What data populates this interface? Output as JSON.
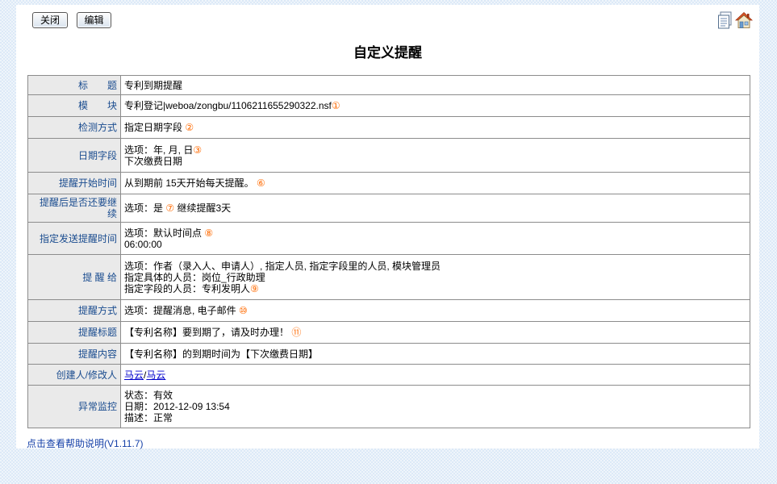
{
  "toolbar": {
    "close_label": "关闭",
    "edit_label": "编辑"
  },
  "page_title": "自定义提醒",
  "labels": {
    "title": "标　　题",
    "module": "模　　块",
    "detect": "检测方式",
    "date_field": "日期字段",
    "start_time": "提醒开始时间",
    "continue": "提醒后是否还要继续",
    "send_time": "指定发送提醒时间",
    "remind_to": "提 醒 给",
    "method": "提醒方式",
    "subject": "提醒标题",
    "content": "提醒内容",
    "creator": "创建人/修改人",
    "monitor": "异常监控"
  },
  "values": {
    "title": "专利到期提醒",
    "module": "专利登记|weboa/zongbu/1106211655290322.nsf",
    "module_num": "①",
    "detect": "指定日期字段",
    "detect_num": "②",
    "date_field_line1": "选项：年, 月, 日",
    "date_field_num": "③",
    "date_field_line2": "下次缴费日期",
    "start_time": "从到期前 15天开始每天提醒。",
    "start_time_num": "⑥",
    "continue_prefix": "选项：是",
    "continue_num": "⑦",
    "continue_suffix": "继续提醒3天",
    "send_time_line1": "选项：默认时间点",
    "send_time_num": "⑧",
    "send_time_line2": "06:00:00",
    "remind_line1": "选项：作者（录入人、申请人）, 指定人员, 指定字段里的人员, 模块管理员",
    "remind_line2": "指定具体的人员：岗位_行政助理",
    "remind_line3": "指定字段的人员：专利发明人",
    "remind_num": "⑨",
    "method": "选项：提醒消息, 电子邮件",
    "method_num": "⑩",
    "subject": "【专利名称】要到期了，请及时办理！",
    "subject_num": "⑪",
    "content": "【专利名称】的到期时间为【下次缴费日期】",
    "creator": "马云",
    "creator_sep": "/",
    "modifier": "马云",
    "monitor_status": "状态：有效",
    "monitor_date": "日期：2012-12-09 13:54",
    "monitor_desc": "描述：正常"
  },
  "footer": {
    "help_text": "点击查看帮助说明",
    "version": "(V1.11.7)"
  },
  "icons": [
    "document-icon",
    "home-icon"
  ]
}
